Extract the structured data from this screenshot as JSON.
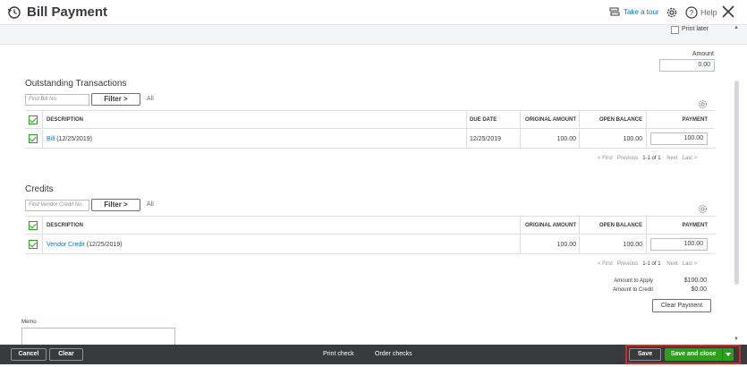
{
  "header": {
    "title": "Bill Payment",
    "tour_label": "Take a tour",
    "help_label": "Help"
  },
  "top": {
    "print_later_label": "Print later",
    "print_later_checked": false,
    "amount_label": "Amount",
    "amount_value": "0.00"
  },
  "outstanding": {
    "title": "Outstanding Transactions",
    "find_placeholder": "Find Bill No.",
    "filter_label": "Filter >",
    "all_label": "All",
    "columns": {
      "description": "DESCRIPTION",
      "due_date": "DUE DATE",
      "original_amount": "ORIGINAL AMOUNT",
      "open_balance": "OPEN BALANCE",
      "payment": "PAYMENT"
    },
    "rows": [
      {
        "checked": true,
        "description_link": "Bill",
        "description_date": " (12/25/2019)",
        "due_date": "12/25/2019",
        "original_amount": "100.00",
        "open_balance": "100.00",
        "payment": "100.00"
      }
    ],
    "pager": {
      "first": "< First",
      "previous": "Previous",
      "range": "1-1 of 1",
      "next": "Next",
      "last": "Last >"
    }
  },
  "credits": {
    "title": "Credits",
    "find_placeholder": "Find Vendor Credit No.",
    "filter_label": "Filter >",
    "all_label": "All",
    "columns": {
      "description": "DESCRIPTION",
      "original_amount": "ORIGINAL AMOUNT",
      "open_balance": "OPEN BALANCE",
      "payment": "PAYMENT"
    },
    "rows": [
      {
        "checked": true,
        "description_link": "Vendor Credit",
        "description_date": " (12/25/2019)",
        "original_amount": "100.00",
        "open_balance": "100.00",
        "payment": "100.00"
      }
    ],
    "pager": {
      "first": "< First",
      "previous": "Previous",
      "range": "1-1 of 1",
      "next": "Next",
      "last": "Last >"
    }
  },
  "summary": {
    "amount_to_apply_label": "Amount to Apply",
    "amount_to_apply_value": "$100.00",
    "amount_to_credit_label": "Amount to Credit",
    "amount_to_credit_value": "$0.00",
    "clear_payment_label": "Clear Payment"
  },
  "memo": {
    "label": "Memo",
    "value": ""
  },
  "footer": {
    "cancel_label": "Cancel",
    "clear_label": "Clear",
    "print_check_label": "Print check",
    "order_checks_label": "Order checks",
    "save_label": "Save",
    "save_close_label": "Save and close"
  },
  "colors": {
    "accent_green": "#2ca01c",
    "link_blue": "#0077c5",
    "footer_dark": "#393a3d",
    "highlight_red": "#d52b1e"
  },
  "icons": [
    "payment-history-icon",
    "take-a-tour-icon",
    "settings-gear-icon",
    "help-icon",
    "close-icon",
    "table-settings-gear-icon",
    "checkbox-checked-icon",
    "dropdown-arrow-icon"
  ]
}
